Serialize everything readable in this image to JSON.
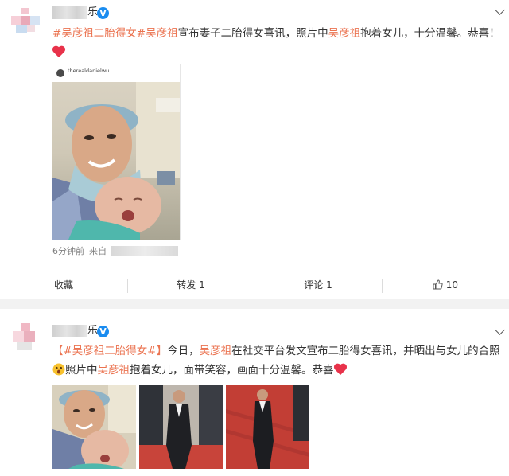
{
  "post1": {
    "author_tail": "乐",
    "verified": "V",
    "hashtag": "#吴彦祖二胎得女#",
    "name1": "吴彦祖",
    "text1": "宣布妻子二胎得女喜讯，照片中",
    "name2": "吴彦祖",
    "text2": "抱着女儿，十分温馨。恭喜！",
    "photo_username": "therealdanielwu",
    "time": "6分钟前",
    "from_label": "来自",
    "actions": {
      "favorite": "收藏",
      "repost": "转发 1",
      "comment": "评论 1",
      "like_count": "10"
    }
  },
  "post2": {
    "author_tail": "乐",
    "verified": "V",
    "bracket_open": "【",
    "hashtag": "#吴彦祖二胎得女#",
    "bracket_close": "】",
    "text_a": "今日，",
    "name1": "吴彦祖",
    "text_b": "在社交平台发文宣布二胎得女喜讯，并晒出与女儿的合照",
    "text_c": "照片中",
    "name2": "吴彦祖",
    "text_d": "抱着女儿，面带笑容，画面十分温馨。恭喜"
  },
  "colors": {
    "link": "#eb7350",
    "verified": "#1a8cf0",
    "heart": "#e8324a"
  },
  "icons": [
    "chevron-down-icon",
    "heart-icon",
    "thumbs-up-icon",
    "verified-icon",
    "surprised-emoji-icon"
  ]
}
